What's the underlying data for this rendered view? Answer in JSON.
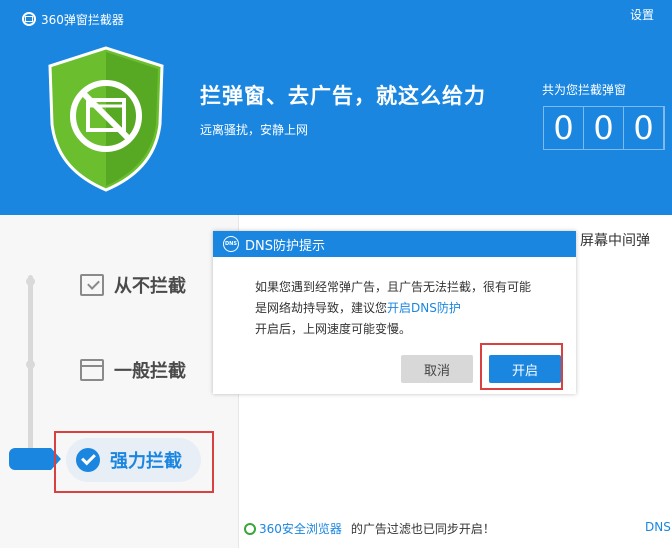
{
  "app": {
    "title": "360弹窗拦截器",
    "settings_label": "设置"
  },
  "hero": {
    "slogan": "拦弹窗、去广告，就这么给力",
    "subslogan": "远离骚扰，安静上网",
    "counter_label": "共为您拦截弹窗",
    "counter_digits": [
      "0",
      "0",
      "0"
    ]
  },
  "levels": {
    "never": "从不拦截",
    "normal": "一般拦截",
    "strong": "强力拦截",
    "selected": "strong"
  },
  "background_text": "、屏幕中间弹",
  "footer": {
    "browser_link": "360安全浏览器",
    "message": "的广告过滤也已同步开启！",
    "dns_fragment": "DNS"
  },
  "dialog": {
    "title": "DNS防护提示",
    "icon_text": "DNS",
    "line1": "如果您遇到经常弹广告，且广告无法拦截，很有可能",
    "line2_prefix": "是网络劫持导致，建议您",
    "line2_link": "开启DNS防护",
    "line3": "开启后，上网速度可能变慢。",
    "cancel_label": "取消",
    "ok_label": "开启"
  },
  "colors": {
    "accent": "#1a86e0",
    "shield": "#6bbf2f",
    "highlight": "#d94141"
  }
}
